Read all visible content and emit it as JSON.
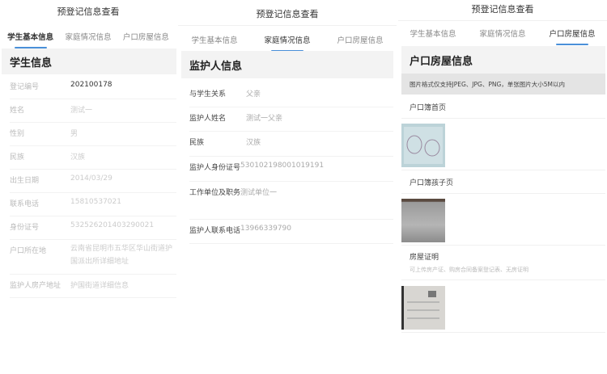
{
  "page_title": "预登记信息查看",
  "tabs": [
    "学生基本信息",
    "家庭情况信息",
    "户口房屋信息"
  ],
  "student": {
    "section": "学生信息",
    "rows": [
      {
        "label": "登记编号",
        "value": "202100178"
      },
      {
        "label": "姓名",
        "value": "测试一"
      },
      {
        "label": "性别",
        "value": "男"
      },
      {
        "label": "民族",
        "value": "汉族"
      },
      {
        "label": "出生日期",
        "value": "2014/03/29"
      },
      {
        "label": "联系电话",
        "value": "15810537021"
      },
      {
        "label": "身份证号",
        "value": "532526201403290021"
      },
      {
        "label": "户口所在地",
        "value": "云南省昆明市五华区华山街道护国派出所详细地址"
      },
      {
        "label": "监护人房产地址",
        "value": "护国街道详细信息"
      }
    ]
  },
  "family": {
    "section": "监护人信息",
    "rows": [
      {
        "label": "与学生关系",
        "value": "父亲"
      },
      {
        "label": "监护人姓名",
        "value": "测试一父亲"
      },
      {
        "label": "民族",
        "value": "汉族"
      },
      {
        "label": "监护人身份证号",
        "value": "530102198001019191"
      },
      {
        "label": "工作单位及职务",
        "value": "测试单位一"
      },
      {
        "label": "监护人联系电话",
        "value": "13966339790"
      }
    ]
  },
  "household": {
    "section": "户口房屋信息",
    "notice": "图片格式仅支持JPEG、JPG、PNG，单张图片大小5M以内",
    "items": [
      {
        "label": "户口簿首页"
      },
      {
        "label": "户口簿孩子页"
      },
      {
        "label": "房屋证明",
        "caption": "可上传房产证、购房合同备案登记表、无房证明"
      }
    ]
  },
  "colors": {
    "accent": "#4a90d9"
  }
}
